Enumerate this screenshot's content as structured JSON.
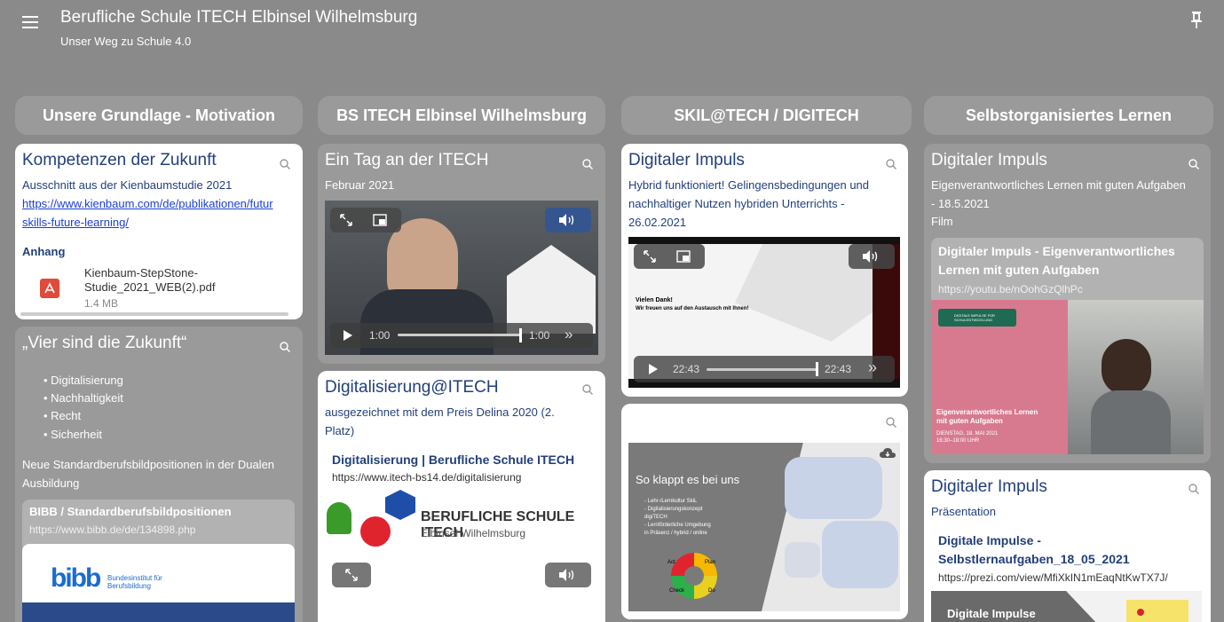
{
  "header": {
    "title": "Berufliche Schule ITECH Elbinsel Wilhelmsburg",
    "subtitle": "Unser Weg zu Schule 4.0"
  },
  "columns": [
    "Unsere Grundlage - Motivation",
    "BS ITECH Elbinsel Wilhelmsburg",
    "SKIL@TECH / DIGITECH",
    "Selbstorganisiertes Lernen"
  ],
  "col1": {
    "card1": {
      "title": "Kompetenzen der Zukunft",
      "text": "Ausschnitt aus der Kienbaumstudie 2021",
      "link_line1": "https://www.kienbaum.com/de/publikationen/futur",
      "link_line2": "skills-future-learning/",
      "attachment_label": "Anhang",
      "file_name_1": "Kienbaum-StepStone-",
      "file_name_2": "Studie_2021_WEB(2).pdf",
      "file_size": "1.4 MB"
    },
    "card2": {
      "title": "„Vier sind die Zukunft“",
      "bullets": [
        "Digitalisierung",
        "Nachhaltigkeit",
        "Recht",
        "Sicherheit"
      ],
      "text1": "Neue Standardberufsbildpositionen in der Dualen",
      "text2": "Ausbildung",
      "link_title": "BIBB / Standardberufsbildpositionen",
      "link_url": "https://www.bibb.de/de/134898.php",
      "logo_word": "bibb",
      "logo_text1": "Bundesinstitut für",
      "logo_text2": "Berufsbildung"
    }
  },
  "col2": {
    "card1": {
      "title": "Ein Tag an der ITECH",
      "text": "Februar 2021",
      "time_current": "1:00",
      "time_total": "1:00"
    },
    "card2": {
      "title": "Digitalisierung@ITECH",
      "text1": "ausgezeichnet mit dem Preis Delina 2020 (2.",
      "text2": "Platz)",
      "link_title": "Digitalisierung | Berufliche Schule ITECH",
      "link_url": "https://www.itech-bs14.de/digitalisierung",
      "logo_line1": "BERUFLICHE SCHULE ITECH",
      "logo_line2": "Elbinsel Wilhelmsburg"
    }
  },
  "col3": {
    "card1": {
      "title": "Digitaler Impuls",
      "text1": "Hybrid funktioniert! Gelingensbedingungen und",
      "text2": "nachhaltiger Nutzen hybriden Unterrichts -",
      "text3": "26.02.2021",
      "slide_line1": "Vielen Dank!",
      "slide_line2": "Wir freuen uns auf den Austausch mit Ihnen!",
      "time_current": "22:43",
      "time_total": "22:43"
    },
    "card2": {
      "slide_title": "So klappt es bei uns",
      "slide_items": [
        "- Lehr-/Lernkultur SkiL",
        "- Digitalisierungskonzept",
        "  digiTECH",
        "- Lernförderliche Umgebung",
        "  in Präsenz / hybrid / online"
      ],
      "cycle": [
        "Act",
        "Plan",
        "Check",
        "Do"
      ]
    }
  },
  "col4": {
    "card1": {
      "title": "Digitaler Impuls",
      "text1": "Eigenverantwortliches Lernen mit guten Aufgaben",
      "text2": "- 18.5.2021",
      "text3": "Film",
      "link_title1": "Digitaler Impuls - Eigenverantwortliches",
      "link_title2": "Lernen mit guten Aufgaben",
      "link_url": "https://youtu.be/nOohGzQlhPc",
      "thumb_caption1": "Eigenverantwortliches Lernen",
      "thumb_caption2": "mit guten Aufgaben",
      "thumb_date": "DIENSTAG, 18. MAI 2021",
      "thumb_time": "16:30–18:00 UHR",
      "thumb_badge": "DIGITALE IMPULSE FÜR SCHULENTWICKLUNG"
    },
    "card2": {
      "title": "Digitaler Impuls",
      "text": "Präsentation",
      "link_title1": "Digitale Impulse -",
      "link_title2": "Selbstlernaufgaben_18_05_2021",
      "link_url": "https://prezi.com/view/MfiXkIN1mEaqNtKwTX7J/",
      "thumb_text": "Digitale Impulse"
    }
  }
}
